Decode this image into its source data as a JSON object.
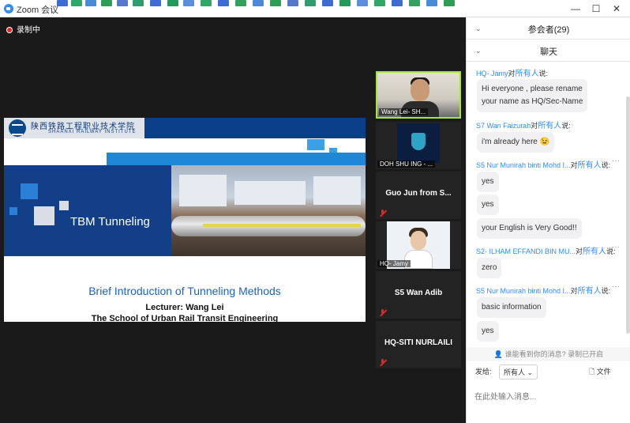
{
  "window": {
    "title": "Zoom 会议",
    "controls": {
      "minimize": "—",
      "maximize": "☐",
      "close": "✕"
    }
  },
  "recording": {
    "label": "录制中",
    "color": "#e02828"
  },
  "slide": {
    "school_cn": "陕西铁路工程职业技术学院",
    "school_en": "SHAANXI RAILWAY INSTITUTE",
    "title": "TBM Tunneling",
    "subtitle": "Brief Introduction of Tunneling Methods",
    "lecturer": "Lecturer:  Wang Lei",
    "school_line": "The School of Urban Rail Transit Engineering",
    "accent": "#123f88"
  },
  "videos": [
    {
      "name": "Wang Lei- SH...",
      "type": "video",
      "active": true
    },
    {
      "name": "DOH SHU ING - ...",
      "type": "logo"
    },
    {
      "name": "Guo Jun from S...",
      "type": "name",
      "muted": true
    },
    {
      "name": "HQ- Jamy",
      "type": "video",
      "muted": true
    },
    {
      "name": "S5 Wan Adib",
      "type": "name",
      "muted": true
    },
    {
      "name": "HQ-SITI NURLAILI",
      "type": "name",
      "muted": true
    }
  ],
  "panel": {
    "participants_label": "参会者(29)",
    "chat_label": "聊天",
    "messages": [
      {
        "sender": "HQ- Jamy",
        "to": "对",
        "audience": "所有人",
        "said": "说:",
        "text": [
          "Hi everyone , please rename",
          "your name as HQ/Sec-Name"
        ]
      },
      {
        "sender": "S7 Wan Faizurah",
        "to": "对",
        "audience": "所有人",
        "said": "说:",
        "text": [
          "i'm already here 😉"
        ]
      },
      {
        "sender": "S5 Nur Munirah binti Mohd I...",
        "to": "对",
        "audience": "所有人",
        "said": "说:",
        "text": [
          "yes"
        ]
      },
      {
        "sender": "",
        "to": "",
        "audience": "",
        "said": "",
        "text": [
          "yes"
        ]
      },
      {
        "sender": "",
        "to": "",
        "audience": "",
        "said": "",
        "text": [
          "your English is Very Good!!"
        ]
      },
      {
        "sender": "S2- ILHAM EFFANDI BIN MU...",
        "to": "对",
        "audience": "所有人",
        "said": "说:",
        "text": [
          "zero"
        ]
      },
      {
        "sender": "S5 Nur Munirah binti Mohd I...",
        "to": "对",
        "audience": "所有人",
        "said": "说:",
        "text": [
          "basic information"
        ]
      },
      {
        "sender": "",
        "to": "",
        "audience": "",
        "said": "",
        "text": [
          "yes"
        ]
      }
    ],
    "more_label": "···",
    "notice": "谁能看到你的消息? 录制已开启",
    "send_to_label": "发给:",
    "send_to_value": "所有人 ⌄",
    "file_label": "文件",
    "input_placeholder": "在此处输入消息..."
  },
  "colors": {
    "link_blue": "#2d8cff",
    "active_border": "#a6e63c"
  }
}
